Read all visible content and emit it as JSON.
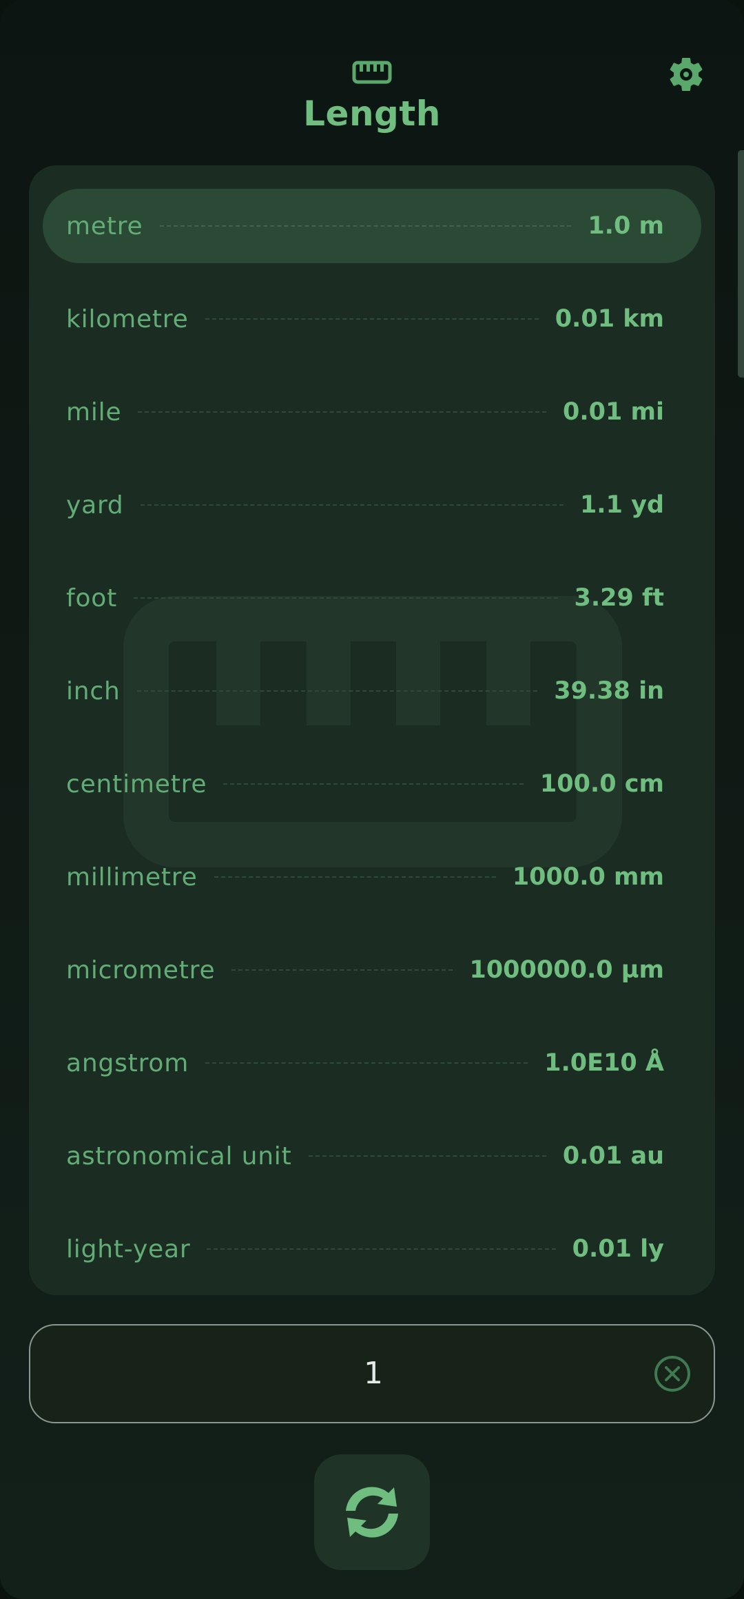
{
  "header": {
    "title": "Length",
    "icon": "ruler-icon",
    "settings_icon": "gear-icon"
  },
  "units": [
    {
      "name": "metre",
      "value": "1.0 m",
      "selected": true
    },
    {
      "name": "kilometre",
      "value": "0.01 km"
    },
    {
      "name": "mile",
      "value": "0.01 mi"
    },
    {
      "name": "yard",
      "value": "1.1 yd"
    },
    {
      "name": "foot",
      "value": "3.29 ft"
    },
    {
      "name": "inch",
      "value": "39.38 in"
    },
    {
      "name": "centimetre",
      "value": "100.0 cm"
    },
    {
      "name": "millimetre",
      "value": "1000.0 mm"
    },
    {
      "name": "micrometre",
      "value": "1000000.0 µm"
    },
    {
      "name": "angstrom",
      "value": "1.0E10 Å"
    },
    {
      "name": "astronomical unit",
      "value": "0.01 au"
    },
    {
      "name": "light-year",
      "value": "0.01 ly"
    }
  ],
  "input": {
    "value": "1",
    "clear_icon": "clear-icon"
  },
  "swap_button": {
    "icon": "swap-icon"
  },
  "colors": {
    "accent": "#6fbe80",
    "background": "#0c1511",
    "card": "#1b2d23",
    "selected_row": "#2b4a35"
  }
}
